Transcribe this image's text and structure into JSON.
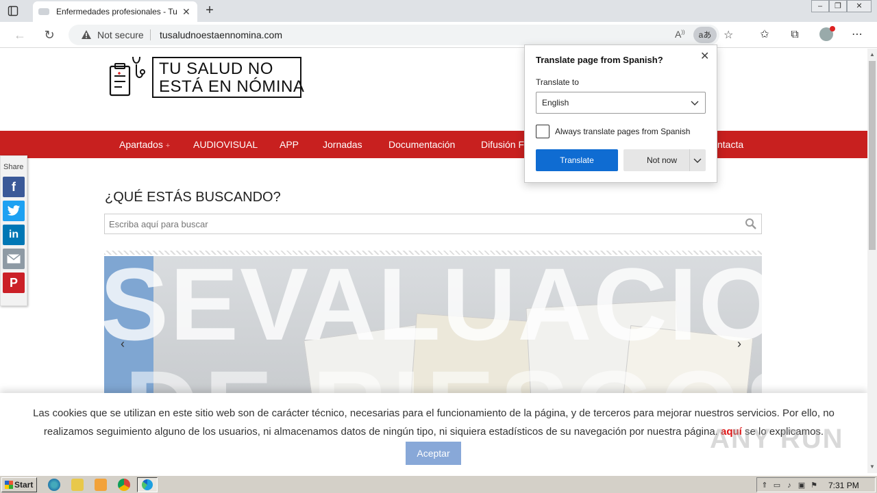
{
  "browser": {
    "tab_title": "Enfermedades profesionales - Tu",
    "url": "tusaludnoestaennomina.com",
    "security_label": "Not secure",
    "translate_icon_label": "aあ"
  },
  "site": {
    "logo": {
      "line1": "TU SALUD NO",
      "line2": "ESTÁ EN NÓMINA"
    },
    "nav": [
      "Apartados",
      "AUDIOVISUAL",
      "APP",
      "Jornadas",
      "Documentación",
      "Difusión F",
      "ntacta"
    ],
    "nav_plus": "+",
    "share_label": "Share",
    "search": {
      "heading": "¿QUÉ ESTÁS BUSCANDO?",
      "placeholder": "Escriba aquí para buscar"
    },
    "slider": {
      "text_top": "SEVALUACION",
      "text_bottom": "DE RIESGOS"
    },
    "cookie": {
      "text_before": "Las cookies que se utilizan en este sitio web son de carácter técnico, necesarias para el funcionamiento de la página, y de terceros para mejorar nuestros servicios. Por ello, no realizamos seguimiento alguno de los usuarios, ni almacenamos datos de ningún tipo, ni siquiera estadísticos de su navegación por nuestra página.",
      "link": "aquí",
      "text_after": "se lo explicamos.",
      "accept": "Aceptar"
    },
    "watermark": "ANY RUN"
  },
  "translate_popup": {
    "title": "Translate page from Spanish?",
    "translate_to_label": "Translate to",
    "language": "English",
    "checkbox_label": "Always translate pages from Spanish",
    "translate_button": "Translate",
    "not_now_button": "Not now"
  },
  "taskbar": {
    "start": "Start",
    "clock": "7:31 PM"
  },
  "colors": {
    "nav_red": "#c8201f",
    "translate_blue": "#0f6cd2",
    "accept_blue": "#88a8d8",
    "facebook": "#3b5998",
    "twitter": "#1da1f2",
    "linkedin": "#0077b5",
    "email": "#8e9aa4",
    "pinterest": "#cb2027"
  }
}
